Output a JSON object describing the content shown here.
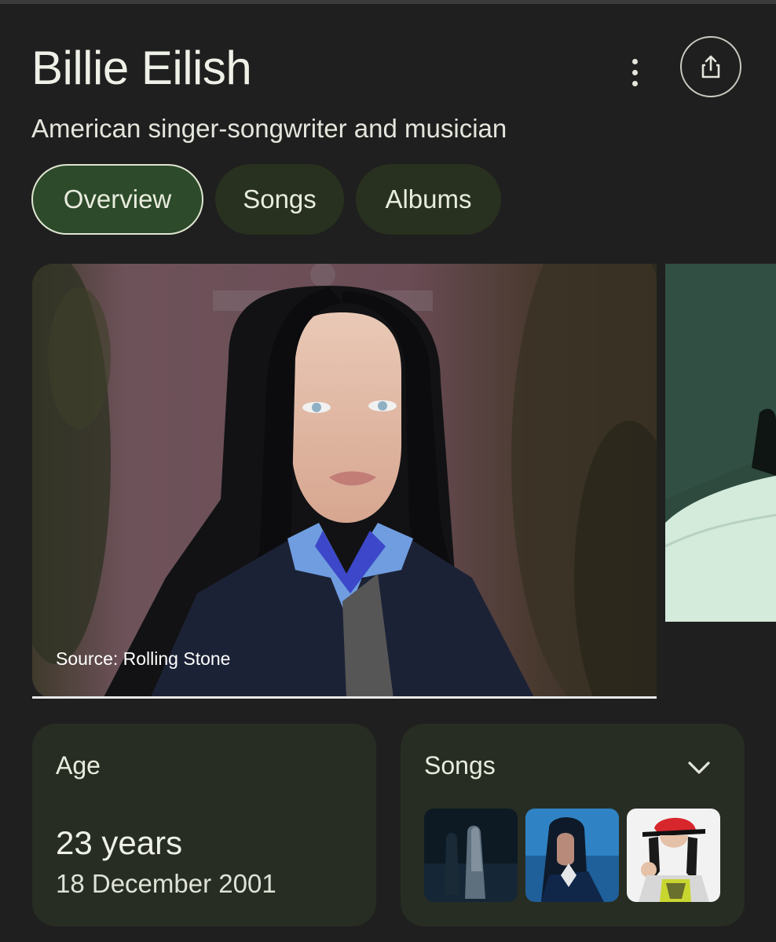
{
  "entity": {
    "title": "Billie Eilish",
    "subtitle": "American singer-songwriter and musician"
  },
  "header_actions": {
    "more_icon": "more-vert-icon",
    "share_icon": "share-icon"
  },
  "tabs": [
    {
      "label": "Overview",
      "active": true
    },
    {
      "label": "Songs",
      "active": false
    },
    {
      "label": "Albums",
      "active": false
    }
  ],
  "image_carousel": {
    "main_image_source": "Source: Rolling Stone"
  },
  "cards": {
    "age": {
      "label": "Age",
      "value": "23 years",
      "birth_date": "18 December 2001"
    },
    "songs": {
      "label": "Songs",
      "expand_icon": "chevron-down-icon",
      "thumbnails": [
        "song-thumbnail-1",
        "song-thumbnail-2",
        "song-thumbnail-3"
      ]
    }
  },
  "colors": {
    "background": "#1f1f1f",
    "chip_bg": "#28311f",
    "chip_active_bg": "#2d4a2a",
    "card_bg": "#282d23",
    "text": "#e8ecde"
  }
}
